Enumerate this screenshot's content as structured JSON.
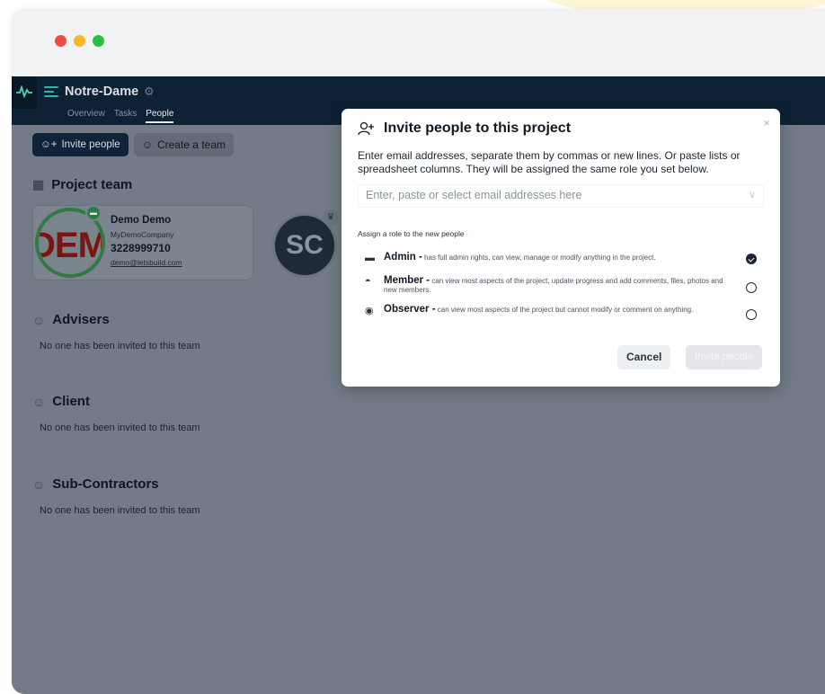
{
  "app": {
    "project_name": "Notre-Dame",
    "tabs": [
      "Overview",
      "Tasks",
      "People"
    ],
    "active_tab": "People"
  },
  "actions": {
    "invite_label": "Invite people",
    "create_team_label": "Create a team"
  },
  "project_team": {
    "title": "Project team",
    "member": {
      "name": "Demo Demo",
      "company": "MyDemoCompany",
      "phone": "3228999710",
      "email": "demo@letsbuild.com",
      "logo_text": "DEMO"
    },
    "second_avatar_initials": "SC"
  },
  "teams": [
    {
      "title": "Advisers",
      "empty_text": "No one has been invited to this team"
    },
    {
      "title": "Client",
      "empty_text": "No one has been invited to this team"
    },
    {
      "title": "Sub-Contractors",
      "empty_text": "No one has been invited to this team"
    }
  ],
  "modal": {
    "title": "Invite people to this project",
    "description": "Enter email addresses, separate them by commas or new lines. Or paste lists or spreadsheet columns. They will be assigned the same role you set below.",
    "email_placeholder": "Enter, paste or select email addresses here",
    "role_heading": "Assign a role to the new people",
    "roles": [
      {
        "name": "Admin -",
        "desc": "has full admin rights, can view, manage or modify anything in the project.",
        "selected": true
      },
      {
        "name": "Member -",
        "desc": "can view most aspects of the project, update progress and add comments, files, photos and new members.",
        "selected": false
      },
      {
        "name": "Observer -",
        "desc": "can view most aspects of the project but cannot modify or comment on anything.",
        "selected": false
      }
    ],
    "cancel_label": "Cancel",
    "invite_label": "Invite people",
    "close_label": "×"
  },
  "colors": {
    "appbar": "#0e2235",
    "overlay_bg": "#727b87",
    "accent_teal": "#2fb7a0",
    "avatar_ring": "#2f7a46"
  }
}
